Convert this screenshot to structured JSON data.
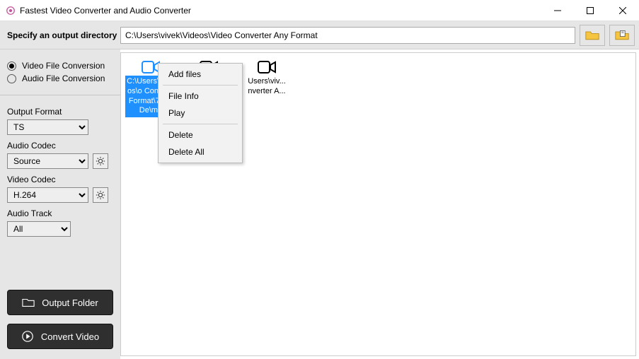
{
  "titlebar": {
    "title": "Fastest Video Converter and Audio Converter"
  },
  "output_bar": {
    "label": "Specify an output directory",
    "path": "C:\\Users\\vivek\\Videos\\Video Converter Any Format"
  },
  "sidebar": {
    "radio_video": "Video File Conversion",
    "radio_audio": "Audio File Conversion",
    "output_format": {
      "label": "Output Format",
      "value": "TS"
    },
    "audio_codec": {
      "label": "Audio Codec",
      "value": "Source"
    },
    "video_codec": {
      "label": "Video Codec",
      "value": "H.264"
    },
    "audio_track": {
      "label": "Audio Track",
      "value": "All"
    },
    "output_folder_btn": "Output Folder",
    "convert_btn": "Convert Video"
  },
  "files": [
    {
      "caption": "C:\\Users\\Videos\\o Conv\\An Format\\7241De\\mp"
    },
    {
      "caption": ""
    },
    {
      "caption": "Users\\viv...\nnverter A..."
    }
  ],
  "context_menu": {
    "add_files": "Add files",
    "file_info": "File Info",
    "play": "Play",
    "delete": "Delete",
    "delete_all": "Delete All"
  }
}
